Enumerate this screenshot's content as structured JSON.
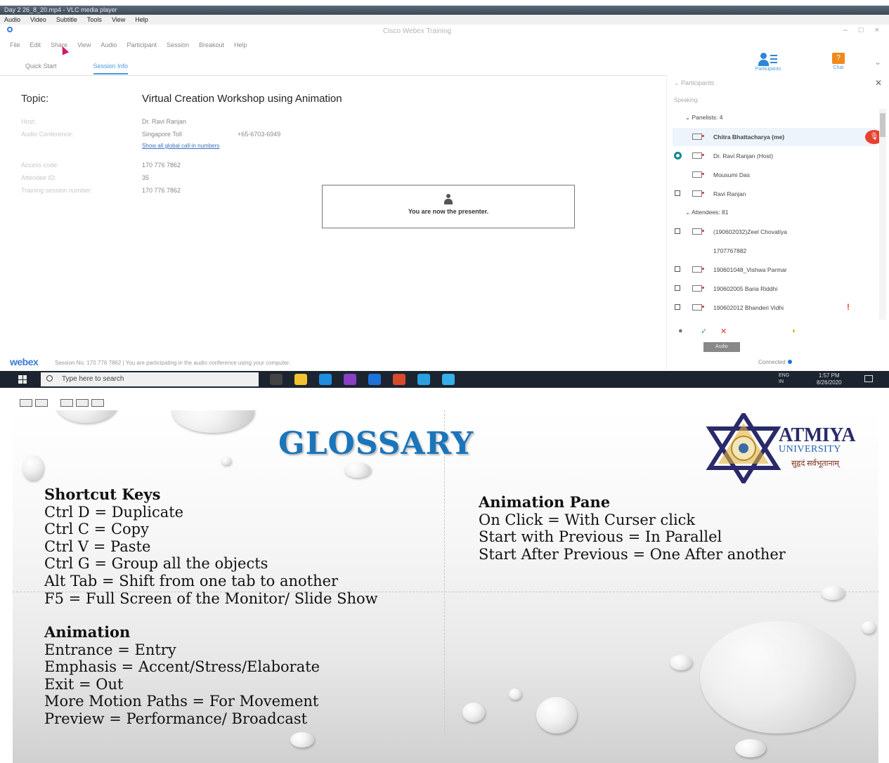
{
  "vlc": {
    "title": "Day 2 26_8_20.mp4 - VLC media player",
    "menu": [
      "Audio",
      "Video",
      "Subtitle",
      "Tools",
      "View",
      "Help"
    ]
  },
  "webex": {
    "window_title": "Cisco Webex Training",
    "window_controls": [
      "–",
      "□",
      "×"
    ],
    "menu": [
      "File",
      "Edit",
      "Share",
      "View",
      "Audio",
      "Participant",
      "Session",
      "Breakout",
      "Help"
    ],
    "tabs": [
      {
        "label": "Quick Start",
        "active": false
      },
      {
        "label": "Session Info",
        "active": true
      }
    ],
    "toolbar": {
      "participants_label": "Participants",
      "chat_label": "Chat",
      "chat_icon_glyph": "?"
    },
    "session": {
      "topic_label": "Topic:",
      "topic_value": "Virtual Creation Workshop using Animation",
      "host_label": "Host:",
      "host_value": "Dr. Ravi Ranjan",
      "audio_label": "Audio Conference:",
      "audio_value": "Singapore Toll",
      "audio_number": "+65-6703-6949",
      "global_link": "Show all global call-in numbers",
      "access_label": "Access code:",
      "access_value": "170 776 7862",
      "attendee_label": "Attendee ID:",
      "attendee_value": "35",
      "training_label": "Training session number:",
      "training_value": "170 776 7862"
    },
    "presenter_message": "You are now the presenter.",
    "status": {
      "logo_a": "web",
      "logo_b": "ex",
      "text": "Session No. 170 776 7862  |  You are participating in the audio conference using your computer."
    },
    "participants": {
      "header": "Participants",
      "speaking": "Speaking:",
      "panelists_group": "Panelists: 4",
      "attendees_group": "Attendees: 81",
      "panelists": [
        "Chitra Bhattacharya (me)",
        "Dr. Ravi Ranjan (Host)",
        "Mousumi Das",
        "Ravi Ranjan"
      ],
      "attendees": [
        "(190602032)Zeel Chovatiya",
        "1707767882",
        "190601048_Vishwa Parmar",
        "190602005 Baria Riddhi",
        "190602012 Bhanderi Vidhi"
      ],
      "tool_icons": [
        "●",
        "✓",
        "✕",
        "◐"
      ],
      "audio_button": "Audio",
      "connected": "Connected"
    }
  },
  "taskbar": {
    "search_placeholder": "Type here to search",
    "lang1": "ENG",
    "lang2": "IN",
    "time": "1:57 PM",
    "date": "8/26/2020",
    "app_colors": [
      "#444444",
      "#f2c230",
      "#1f8de0",
      "#8a3fc4",
      "#1c74d8",
      "#d84a2a",
      "#2aa0e0",
      "#35b0e8"
    ]
  },
  "slide": {
    "title": "GLOSSARY",
    "logo": {
      "name": "ATMIYA",
      "sub": "UNIVERSITY",
      "motto": "सुहृदं सर्वभूतानाम्"
    },
    "shortcut_heading": "Shortcut Keys",
    "shortcuts": [
      "Ctrl D = Duplicate",
      "Ctrl C = Copy",
      "Ctrl V = Paste",
      "Ctrl G = Group all the objects",
      "Alt Tab = Shift from one tab to another",
      "F5 = Full Screen of the Monitor/ Slide Show"
    ],
    "animation_heading": "Animation",
    "animation": [
      "Entrance = Entry",
      "Emphasis = Accent/Stress/Elaborate",
      "Exit = Out",
      "More Motion Paths = For Movement",
      "Preview = Performance/ Broadcast"
    ],
    "pane_heading": "Animation Pane",
    "pane": [
      "On Click = With Curser click",
      "Start with Previous = In Parallel",
      "Start After Previous = One After another"
    ]
  }
}
